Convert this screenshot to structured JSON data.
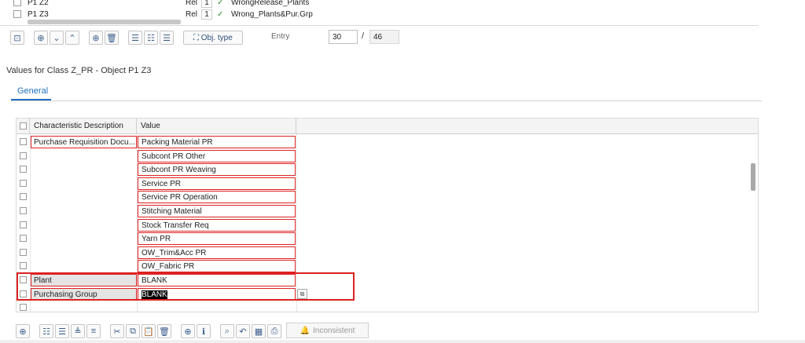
{
  "top_table": {
    "rows": [
      {
        "object": "P1 Z2",
        "rel": "Rel",
        "num": "1",
        "check": "✓",
        "desc": "WrongRelease_Plants"
      },
      {
        "object": "P1 Z3",
        "rel": "Rel",
        "num": "1",
        "check": "✓",
        "desc": "Wrong_Plants&Pur.Grp"
      }
    ]
  },
  "toolbar": {
    "obj_type_label": "Obj. type",
    "entry_label": "Entry",
    "entry_value": "30",
    "entry_separator": "/",
    "entry_total": "46"
  },
  "section": {
    "title": "Values for Class Z_PR - Object P1 Z3",
    "tab_general": "General"
  },
  "grid": {
    "col_desc_header": "Characteristic Description",
    "col_value_header": "Value",
    "rows": [
      {
        "desc": "Purchase Requisition Docu...",
        "value": "Packing Material PR"
      },
      {
        "desc": "",
        "value": "Subcont PR Other"
      },
      {
        "desc": "",
        "value": "Subcont PR Weaving"
      },
      {
        "desc": "",
        "value": "Service PR"
      },
      {
        "desc": "",
        "value": "Service PR Operation"
      },
      {
        "desc": "",
        "value": "Stitching Material"
      },
      {
        "desc": "",
        "value": "Stock Transfer Req"
      },
      {
        "desc": "",
        "value": "Yarn PR"
      },
      {
        "desc": "",
        "value": "OW_Trim&Acc PR"
      },
      {
        "desc": "",
        "value": "OW_Fabric PR"
      },
      {
        "desc": "Plant",
        "value": "BLANK"
      },
      {
        "desc": "Purchasing Group",
        "value": "BLANK"
      },
      {
        "desc": "",
        "value": ""
      }
    ]
  },
  "bottom_toolbar": {
    "inconsistent_label": "Inconsistent"
  },
  "colors": {
    "accent": "#1f6fbf",
    "highlight_red": "#dd2222",
    "check_green": "#2e8b2e"
  }
}
